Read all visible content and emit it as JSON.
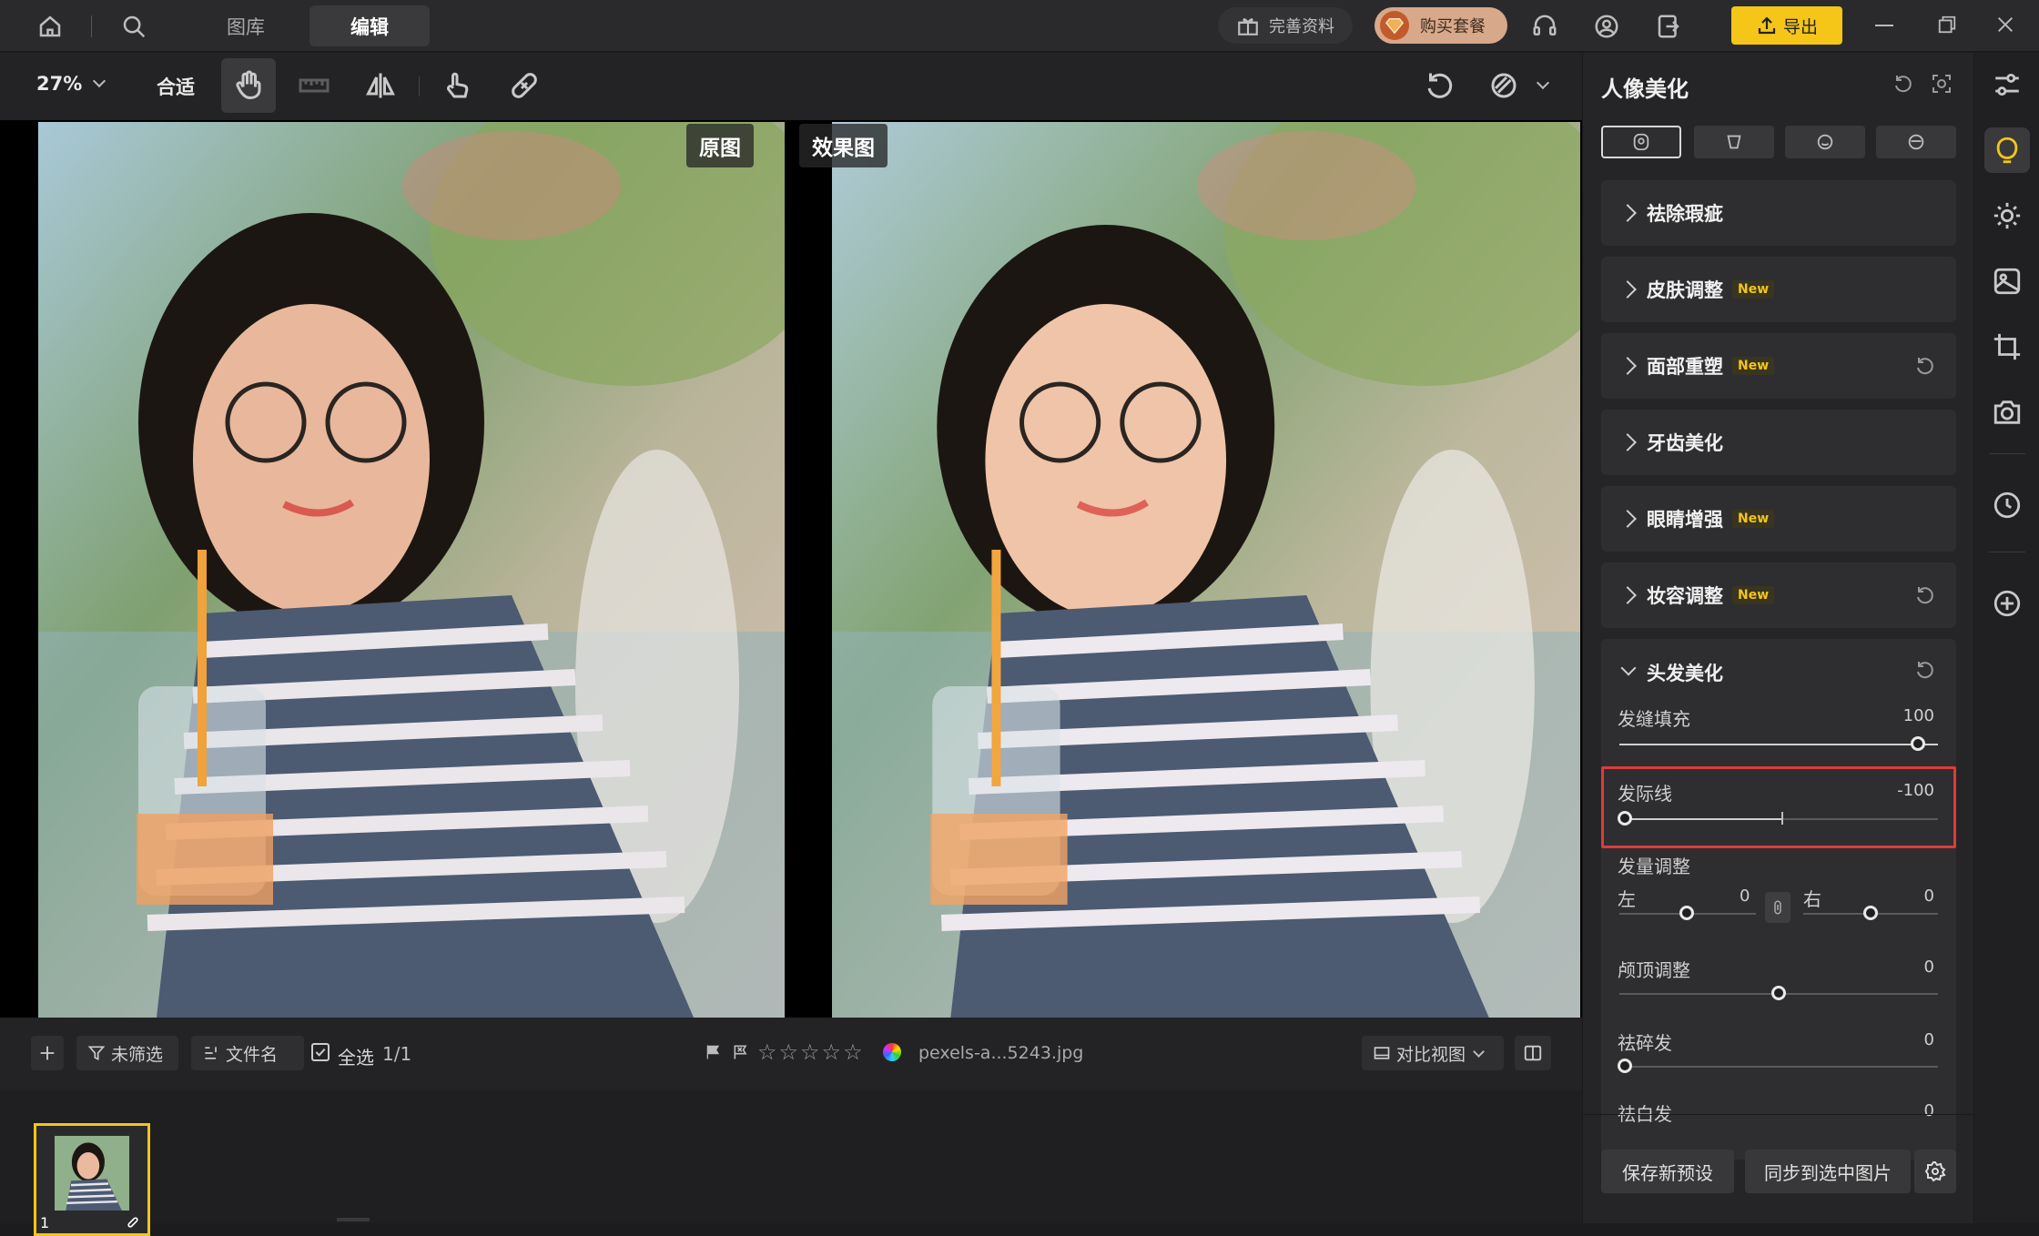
{
  "nav": {
    "gallery": "图库",
    "edit": "编辑",
    "complete_profile": "完善资料",
    "buy_package": "购买套餐",
    "export": "导出"
  },
  "toolbar": {
    "zoom": "27%",
    "fit": "合适"
  },
  "canvas": {
    "original_label": "原图",
    "effect_label": "效果图"
  },
  "bottom": {
    "filter": "未筛选",
    "sort": "文件名",
    "select_all": "全选",
    "count": "1/1",
    "filename": "pexels-a...5243.jpg",
    "compare_view": "对比视图",
    "thumb_index": "1"
  },
  "panel": {
    "title": "人像美化",
    "sections": [
      {
        "label": "祛除瑕疵",
        "new": ""
      },
      {
        "label": "皮肤调整",
        "new": "New"
      },
      {
        "label": "面部重塑",
        "new": "New"
      },
      {
        "label": "牙齿美化",
        "new": ""
      },
      {
        "label": "眼睛增强",
        "new": "New"
      },
      {
        "label": "妆容调整",
        "new": "New"
      }
    ],
    "hair": {
      "title": "头发美化",
      "gap_fill_label": "发缝填充",
      "gap_fill_value": "100",
      "hairline_label": "发际线",
      "hairline_value": "-100",
      "volume_label": "发量调整",
      "left_label": "左",
      "left_value": "0",
      "right_label": "右",
      "right_value": "0",
      "crown_label": "颅顶调整",
      "crown_value": "0",
      "frizz_label": "祛碎发",
      "frizz_value": "0",
      "white_label": "祛白发",
      "white_value": "0"
    },
    "save_preset": "保存新预设",
    "sync": "同步到选中图片"
  },
  "colors": {
    "export_yellow": "#f5c518",
    "highlight_red": "#e03a3a",
    "thumb_border": "#f5c518"
  }
}
